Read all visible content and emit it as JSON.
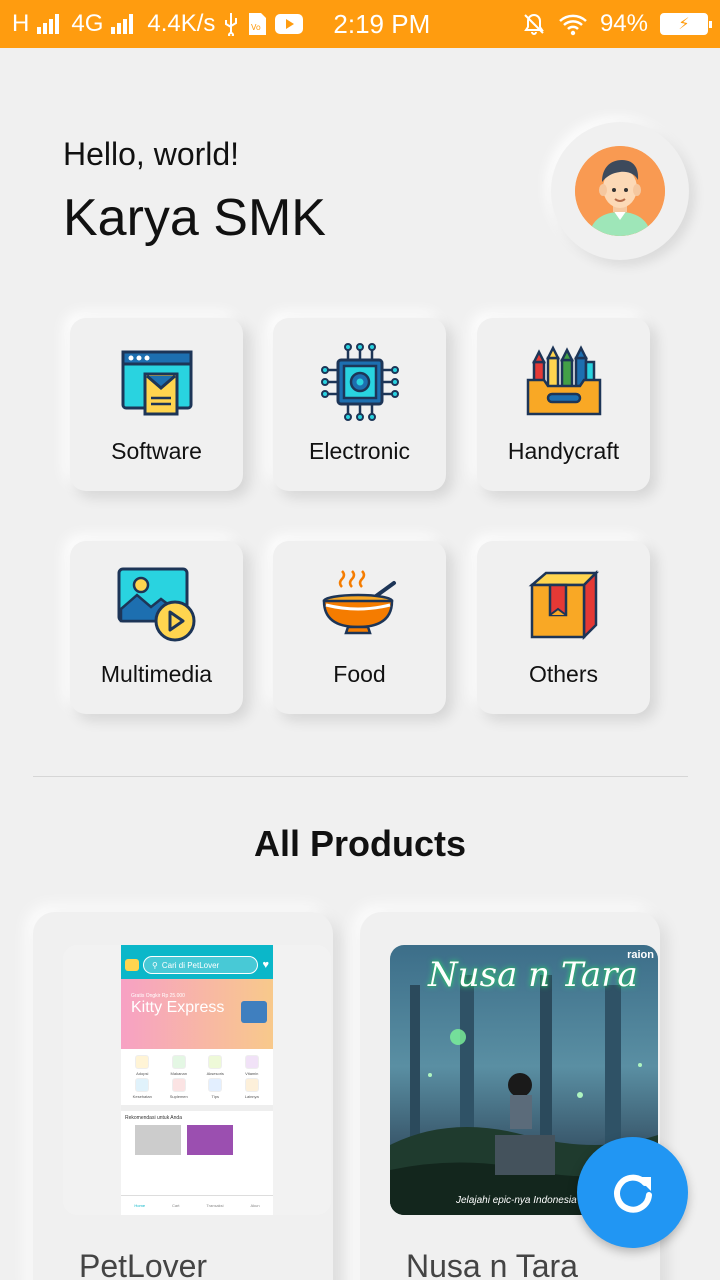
{
  "status_bar": {
    "network_h": "H",
    "network_4g": "4G",
    "speed": "4.4K/s",
    "time": "2:19 PM",
    "battery_percent": "94%",
    "icons": [
      "signal-icon",
      "usb-icon",
      "vpn-icon",
      "youtube-icon",
      "mute-icon",
      "wifi-icon",
      "battery-charging-icon"
    ]
  },
  "header": {
    "greeting": "Hello, world!",
    "title": "Karya SMK"
  },
  "categories": [
    {
      "label": "Software",
      "icon": "software-icon"
    },
    {
      "label": "Electronic",
      "icon": "chip-icon"
    },
    {
      "label": "Handycraft",
      "icon": "crayon-box-icon"
    },
    {
      "label": "Multimedia",
      "icon": "multimedia-icon"
    },
    {
      "label": "Food",
      "icon": "soup-bowl-icon"
    },
    {
      "label": "Others",
      "icon": "box-icon"
    }
  ],
  "section_title": "All Products",
  "products": [
    {
      "name": "PetLover",
      "shot": {
        "search_placeholder": "Cari di PetLover",
        "banner_line1": "Gratis Ongkir Rp 25.000",
        "banner_title": "Kitty Express",
        "menu": [
          "Adopsi",
          "Makanan",
          "Aksesoris",
          "Vitamin",
          "Kesehatan",
          "Suplemen",
          "Tips",
          "Lainnya"
        ],
        "recommend": "Rekomendasi untuk Anda",
        "nav": [
          "Home",
          "Cart",
          "Transaksi",
          "Akun"
        ]
      }
    },
    {
      "name": "Nusa n Tara",
      "shot": {
        "title": "Nusa n Tara",
        "brand": "raion",
        "tagline": "Jelajahi epic-nya Indonesia"
      }
    }
  ],
  "fab": {
    "icon": "refresh-icon"
  },
  "colors": {
    "status_bar": "#ff9c0f",
    "background": "#f0f0f0",
    "fab": "#2196f3",
    "avatar": "#f99a52"
  }
}
